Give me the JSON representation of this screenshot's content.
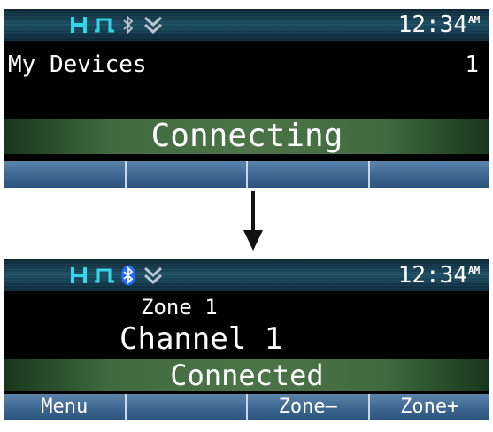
{
  "colors": {
    "screen_bg": "#000000",
    "status_bar": "#1c4d62",
    "icon_cyan": "#2fd6e8",
    "icon_gray": "#b9c6cf",
    "bluetooth_connected": "#1e66ff",
    "banner_green": "#4d7449",
    "softkey_blue": "#3c6690"
  },
  "top": {
    "status_icons": [
      "h-icon",
      "pulse-icon",
      "bluetooth-icon",
      "signal-chevron-icon"
    ],
    "clock": "12:34",
    "clock_ampm": "AM",
    "title": "My Devices",
    "count": "1",
    "banner": "Connecting",
    "softkeys": [
      "",
      "",
      "",
      ""
    ]
  },
  "bottom": {
    "status_icons": [
      "h-icon",
      "pulse-icon",
      "bluetooth-connected-icon",
      "signal-chevron-icon"
    ],
    "clock": "12:34",
    "clock_ampm": "AM",
    "zone": "Zone 1",
    "channel": "Channel 1",
    "banner": "Connected",
    "softkeys": [
      "Menu",
      "",
      "Zone–",
      "Zone+"
    ]
  },
  "transition_icon": "arrow-down-icon"
}
